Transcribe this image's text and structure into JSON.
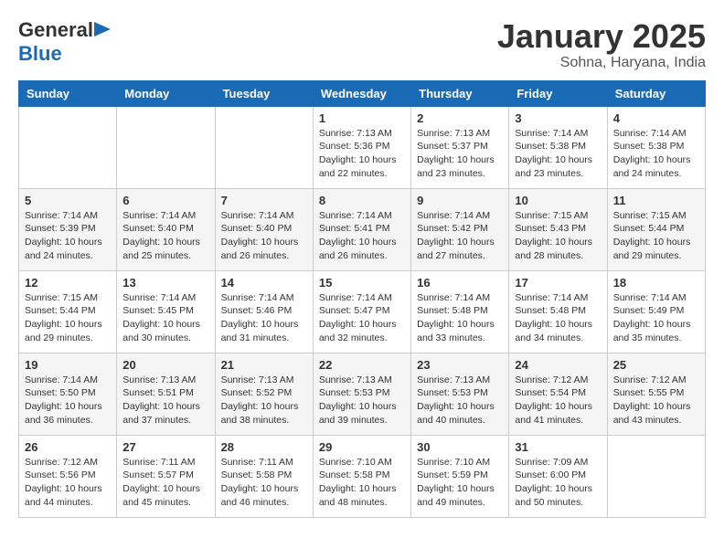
{
  "header": {
    "logo_general": "General",
    "logo_blue": "Blue",
    "month_title": "January 2025",
    "location": "Sohna, Haryana, India"
  },
  "weekdays": [
    "Sunday",
    "Monday",
    "Tuesday",
    "Wednesday",
    "Thursday",
    "Friday",
    "Saturday"
  ],
  "weeks": [
    [
      {
        "day": "",
        "info": ""
      },
      {
        "day": "",
        "info": ""
      },
      {
        "day": "",
        "info": ""
      },
      {
        "day": "1",
        "info": "Sunrise: 7:13 AM\nSunset: 5:36 PM\nDaylight: 10 hours\nand 22 minutes."
      },
      {
        "day": "2",
        "info": "Sunrise: 7:13 AM\nSunset: 5:37 PM\nDaylight: 10 hours\nand 23 minutes."
      },
      {
        "day": "3",
        "info": "Sunrise: 7:14 AM\nSunset: 5:38 PM\nDaylight: 10 hours\nand 23 minutes."
      },
      {
        "day": "4",
        "info": "Sunrise: 7:14 AM\nSunset: 5:38 PM\nDaylight: 10 hours\nand 24 minutes."
      }
    ],
    [
      {
        "day": "5",
        "info": "Sunrise: 7:14 AM\nSunset: 5:39 PM\nDaylight: 10 hours\nand 24 minutes."
      },
      {
        "day": "6",
        "info": "Sunrise: 7:14 AM\nSunset: 5:40 PM\nDaylight: 10 hours\nand 25 minutes."
      },
      {
        "day": "7",
        "info": "Sunrise: 7:14 AM\nSunset: 5:40 PM\nDaylight: 10 hours\nand 26 minutes."
      },
      {
        "day": "8",
        "info": "Sunrise: 7:14 AM\nSunset: 5:41 PM\nDaylight: 10 hours\nand 26 minutes."
      },
      {
        "day": "9",
        "info": "Sunrise: 7:14 AM\nSunset: 5:42 PM\nDaylight: 10 hours\nand 27 minutes."
      },
      {
        "day": "10",
        "info": "Sunrise: 7:15 AM\nSunset: 5:43 PM\nDaylight: 10 hours\nand 28 minutes."
      },
      {
        "day": "11",
        "info": "Sunrise: 7:15 AM\nSunset: 5:44 PM\nDaylight: 10 hours\nand 29 minutes."
      }
    ],
    [
      {
        "day": "12",
        "info": "Sunrise: 7:15 AM\nSunset: 5:44 PM\nDaylight: 10 hours\nand 29 minutes."
      },
      {
        "day": "13",
        "info": "Sunrise: 7:14 AM\nSunset: 5:45 PM\nDaylight: 10 hours\nand 30 minutes."
      },
      {
        "day": "14",
        "info": "Sunrise: 7:14 AM\nSunset: 5:46 PM\nDaylight: 10 hours\nand 31 minutes."
      },
      {
        "day": "15",
        "info": "Sunrise: 7:14 AM\nSunset: 5:47 PM\nDaylight: 10 hours\nand 32 minutes."
      },
      {
        "day": "16",
        "info": "Sunrise: 7:14 AM\nSunset: 5:48 PM\nDaylight: 10 hours\nand 33 minutes."
      },
      {
        "day": "17",
        "info": "Sunrise: 7:14 AM\nSunset: 5:48 PM\nDaylight: 10 hours\nand 34 minutes."
      },
      {
        "day": "18",
        "info": "Sunrise: 7:14 AM\nSunset: 5:49 PM\nDaylight: 10 hours\nand 35 minutes."
      }
    ],
    [
      {
        "day": "19",
        "info": "Sunrise: 7:14 AM\nSunset: 5:50 PM\nDaylight: 10 hours\nand 36 minutes."
      },
      {
        "day": "20",
        "info": "Sunrise: 7:13 AM\nSunset: 5:51 PM\nDaylight: 10 hours\nand 37 minutes."
      },
      {
        "day": "21",
        "info": "Sunrise: 7:13 AM\nSunset: 5:52 PM\nDaylight: 10 hours\nand 38 minutes."
      },
      {
        "day": "22",
        "info": "Sunrise: 7:13 AM\nSunset: 5:53 PM\nDaylight: 10 hours\nand 39 minutes."
      },
      {
        "day": "23",
        "info": "Sunrise: 7:13 AM\nSunset: 5:53 PM\nDaylight: 10 hours\nand 40 minutes."
      },
      {
        "day": "24",
        "info": "Sunrise: 7:12 AM\nSunset: 5:54 PM\nDaylight: 10 hours\nand 41 minutes."
      },
      {
        "day": "25",
        "info": "Sunrise: 7:12 AM\nSunset: 5:55 PM\nDaylight: 10 hours\nand 43 minutes."
      }
    ],
    [
      {
        "day": "26",
        "info": "Sunrise: 7:12 AM\nSunset: 5:56 PM\nDaylight: 10 hours\nand 44 minutes."
      },
      {
        "day": "27",
        "info": "Sunrise: 7:11 AM\nSunset: 5:57 PM\nDaylight: 10 hours\nand 45 minutes."
      },
      {
        "day": "28",
        "info": "Sunrise: 7:11 AM\nSunset: 5:58 PM\nDaylight: 10 hours\nand 46 minutes."
      },
      {
        "day": "29",
        "info": "Sunrise: 7:10 AM\nSunset: 5:58 PM\nDaylight: 10 hours\nand 48 minutes."
      },
      {
        "day": "30",
        "info": "Sunrise: 7:10 AM\nSunset: 5:59 PM\nDaylight: 10 hours\nand 49 minutes."
      },
      {
        "day": "31",
        "info": "Sunrise: 7:09 AM\nSunset: 6:00 PM\nDaylight: 10 hours\nand 50 minutes."
      },
      {
        "day": "",
        "info": ""
      }
    ]
  ]
}
